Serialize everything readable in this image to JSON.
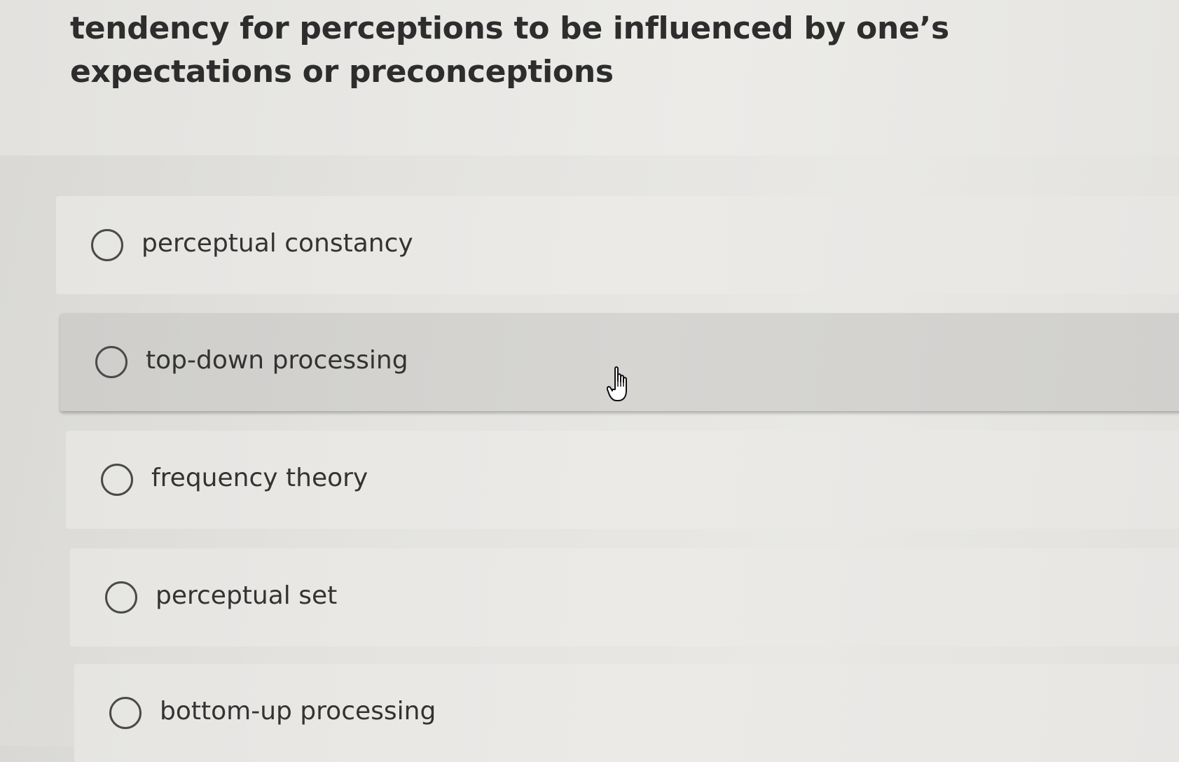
{
  "question": {
    "text": "tendency for perceptions to be influenced by one’s expectations or preconceptions"
  },
  "options": [
    {
      "label": "perceptual constancy",
      "selected": false
    },
    {
      "label": "top-down processing",
      "selected": false,
      "hovered": true
    },
    {
      "label": "frequency theory",
      "selected": false
    },
    {
      "label": "perceptual set",
      "selected": false
    },
    {
      "label": "bottom-up processing",
      "selected": false
    }
  ],
  "cursor": {
    "icon": "hand-pointer-icon"
  }
}
